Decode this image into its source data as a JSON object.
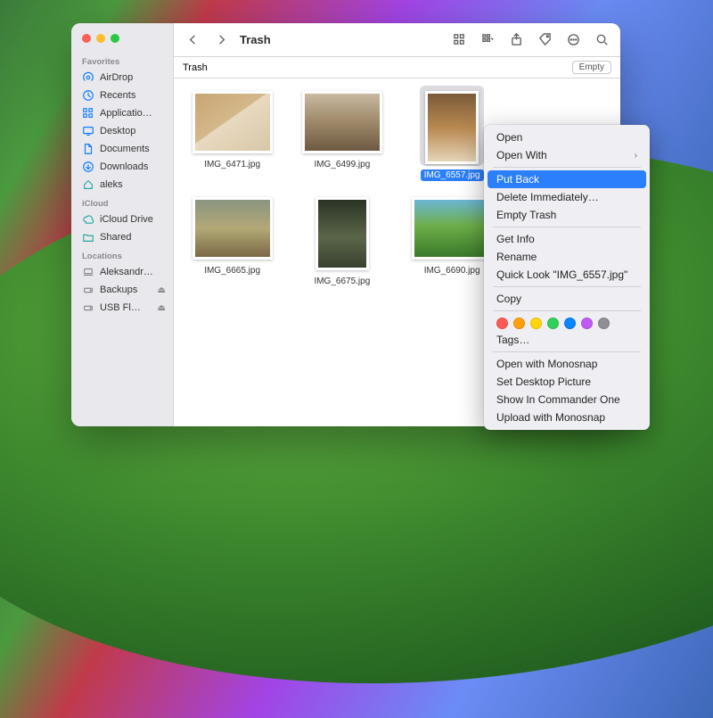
{
  "window": {
    "title": "Trash"
  },
  "sidebar": {
    "groups": [
      {
        "label": "Favorites",
        "items": [
          {
            "icon": "airdrop",
            "label": "AirDrop"
          },
          {
            "icon": "clock",
            "label": "Recents"
          },
          {
            "icon": "apps",
            "label": "Applicatio…"
          },
          {
            "icon": "desktop",
            "label": "Desktop"
          },
          {
            "icon": "doc",
            "label": "Documents"
          },
          {
            "icon": "down",
            "label": "Downloads"
          },
          {
            "icon": "home",
            "label": "aleks"
          }
        ]
      },
      {
        "label": "iCloud",
        "items": [
          {
            "icon": "cloud",
            "label": "iCloud Drive"
          },
          {
            "icon": "folder",
            "label": "Shared"
          }
        ]
      },
      {
        "label": "Locations",
        "items": [
          {
            "icon": "laptop",
            "label": "Aleksandr…"
          },
          {
            "icon": "disk",
            "label": "Backups",
            "eject": true
          },
          {
            "icon": "disk",
            "label": "USB Fl…",
            "eject": true
          }
        ]
      }
    ]
  },
  "pathbar": {
    "location": "Trash",
    "empty_label": "Empty"
  },
  "files": [
    {
      "name": "IMG_6471.jpg",
      "orient": "land",
      "swatch": "cat1"
    },
    {
      "name": "IMG_6499.jpg",
      "orient": "land",
      "swatch": "cat2"
    },
    {
      "name": "IMG_6557.jpg",
      "orient": "port",
      "swatch": "cat3",
      "selected": true
    },
    {
      "name": "",
      "orient": "port",
      "swatch": "cat3",
      "partial": true
    },
    {
      "name": "IMG_6665.jpg",
      "orient": "land",
      "swatch": "dog1"
    },
    {
      "name": "IMG_6675.jpg",
      "orient": "port",
      "swatch": "dog2"
    },
    {
      "name": "IMG_6690.jpg",
      "orient": "land",
      "swatch": "dog3"
    },
    {
      "name": "",
      "orient": "land",
      "swatch": "dog3",
      "partial": true
    }
  ],
  "context_menu": {
    "groups": [
      [
        {
          "label": "Open"
        },
        {
          "label": "Open With",
          "submenu": true
        }
      ],
      [
        {
          "label": "Put Back",
          "highlighted": true
        },
        {
          "label": "Delete Immediately…"
        },
        {
          "label": "Empty Trash"
        }
      ],
      [
        {
          "label": "Get Info"
        },
        {
          "label": "Rename"
        },
        {
          "label": "Quick Look \"IMG_6557.jpg\""
        }
      ],
      [
        {
          "label": "Copy"
        }
      ],
      [
        {
          "tags": [
            "#ff5b54",
            "#ff9f0a",
            "#ffd60a",
            "#30d158",
            "#0a84ff",
            "#bf5af2",
            "#8e8e93"
          ]
        },
        {
          "label": "Tags…"
        }
      ],
      [
        {
          "label": "Open with Monosnap"
        },
        {
          "label": "Set Desktop Picture"
        },
        {
          "label": "Show In Commander One"
        },
        {
          "label": "Upload with Monosnap"
        }
      ]
    ]
  }
}
